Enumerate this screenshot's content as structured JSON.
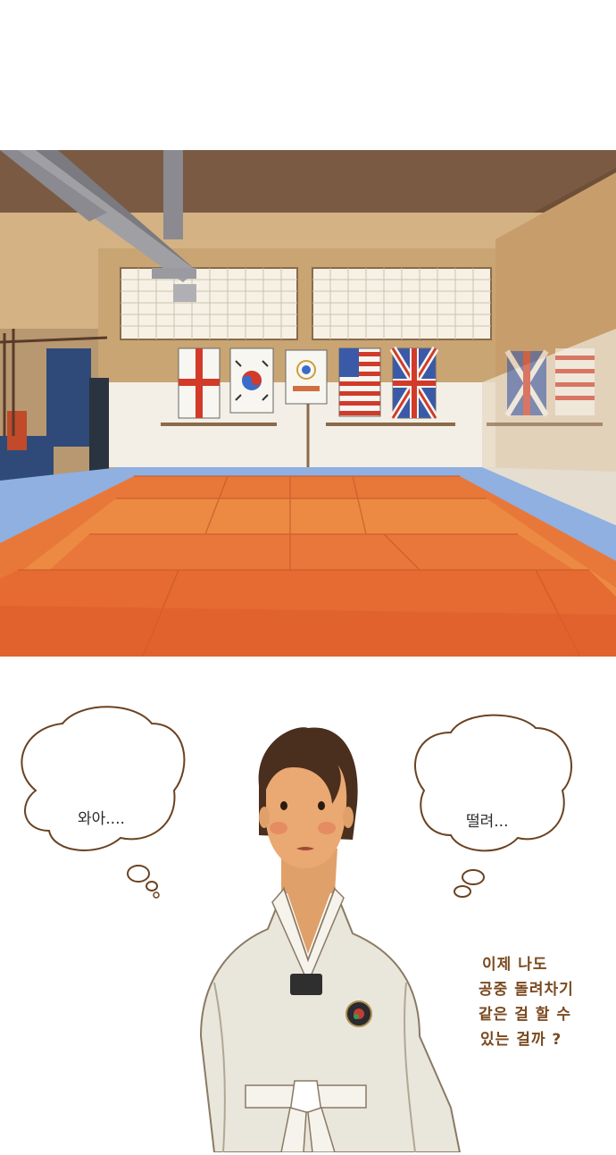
{
  "bubbles": {
    "left_text": "와아....",
    "right_text": "떨려..."
  },
  "monologue": {
    "lines": [
      "이제 나도",
      "공중 돌려차기",
      "같은 걸 할 수",
      "있는 걸까 ?"
    ]
  },
  "colors": {
    "mat_orange": "#e8783a",
    "mat_border": "#8fb0e0",
    "wall": "#d9b98a",
    "ceiling": "#7a5a40",
    "ink": "#7a4a20"
  },
  "flags": [
    "england-flag",
    "korea-flag",
    "taekwondo-emblem-banner",
    "usa-flag",
    "uk-flag"
  ]
}
